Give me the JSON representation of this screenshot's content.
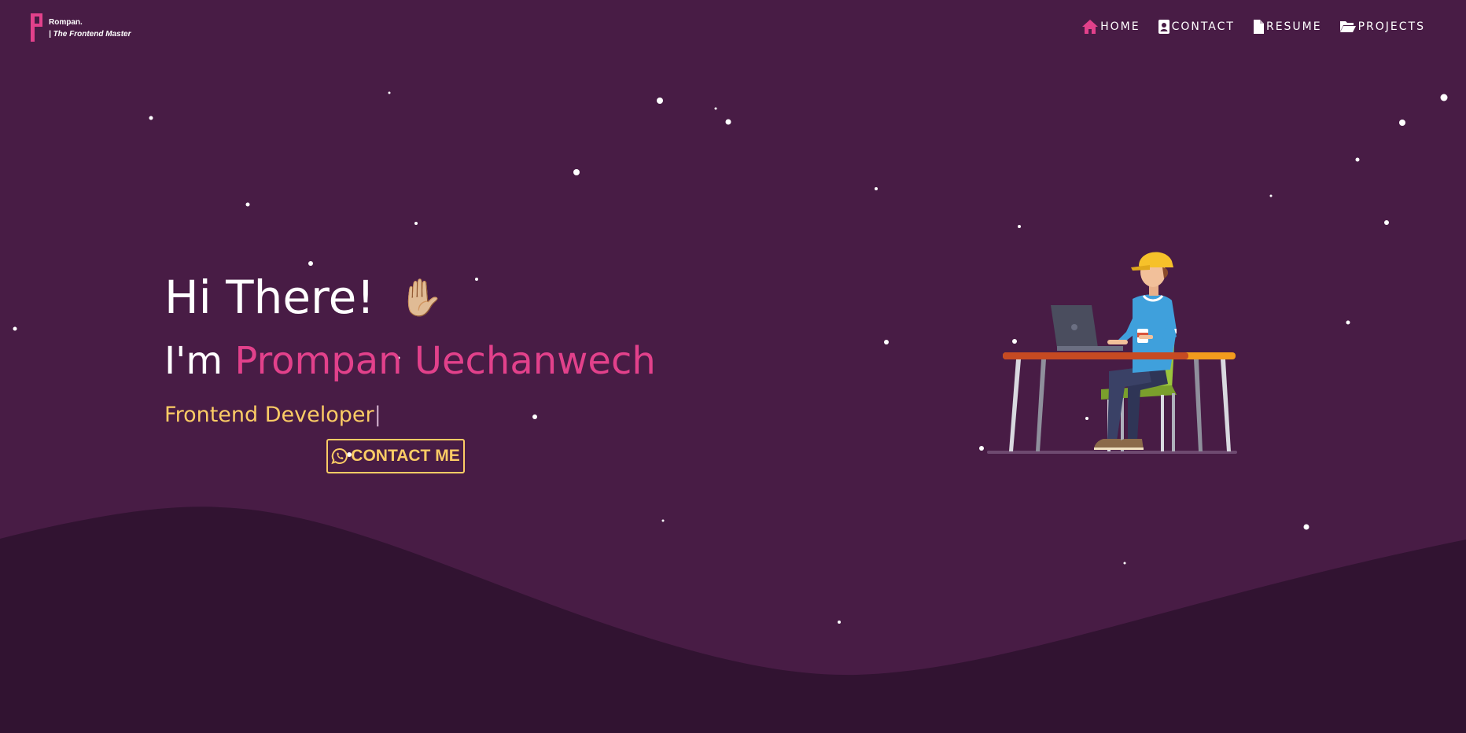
{
  "brand": {
    "name": "Rompan.",
    "tagline": "| The Frontend Master",
    "color": "#e2418b"
  },
  "nav": {
    "items": [
      {
        "label": "HOME",
        "icon": "home-icon"
      },
      {
        "label": "CONTACT",
        "icon": "contact-card-icon"
      },
      {
        "label": "RESUME",
        "icon": "document-icon"
      },
      {
        "label": "PROJECTS",
        "icon": "folder-open-icon"
      }
    ]
  },
  "hero": {
    "greeting": "Hi There!",
    "greeting_emoji": "✋🏼",
    "intro_prefix": "I'm",
    "name": "Prompan Uechanwech",
    "role": "Frontend Developer",
    "cursor": "|"
  },
  "cta": {
    "label": "CONTACT ME",
    "icon": "whatsapp-icon"
  },
  "illustration": {
    "icon": "developer-at-desk-illustration"
  },
  "colors": {
    "background": "#481c45",
    "wave": "#311331",
    "accent_pink": "#e2418b",
    "accent_yellow": "#fccc65",
    "text": "#ffffff"
  }
}
